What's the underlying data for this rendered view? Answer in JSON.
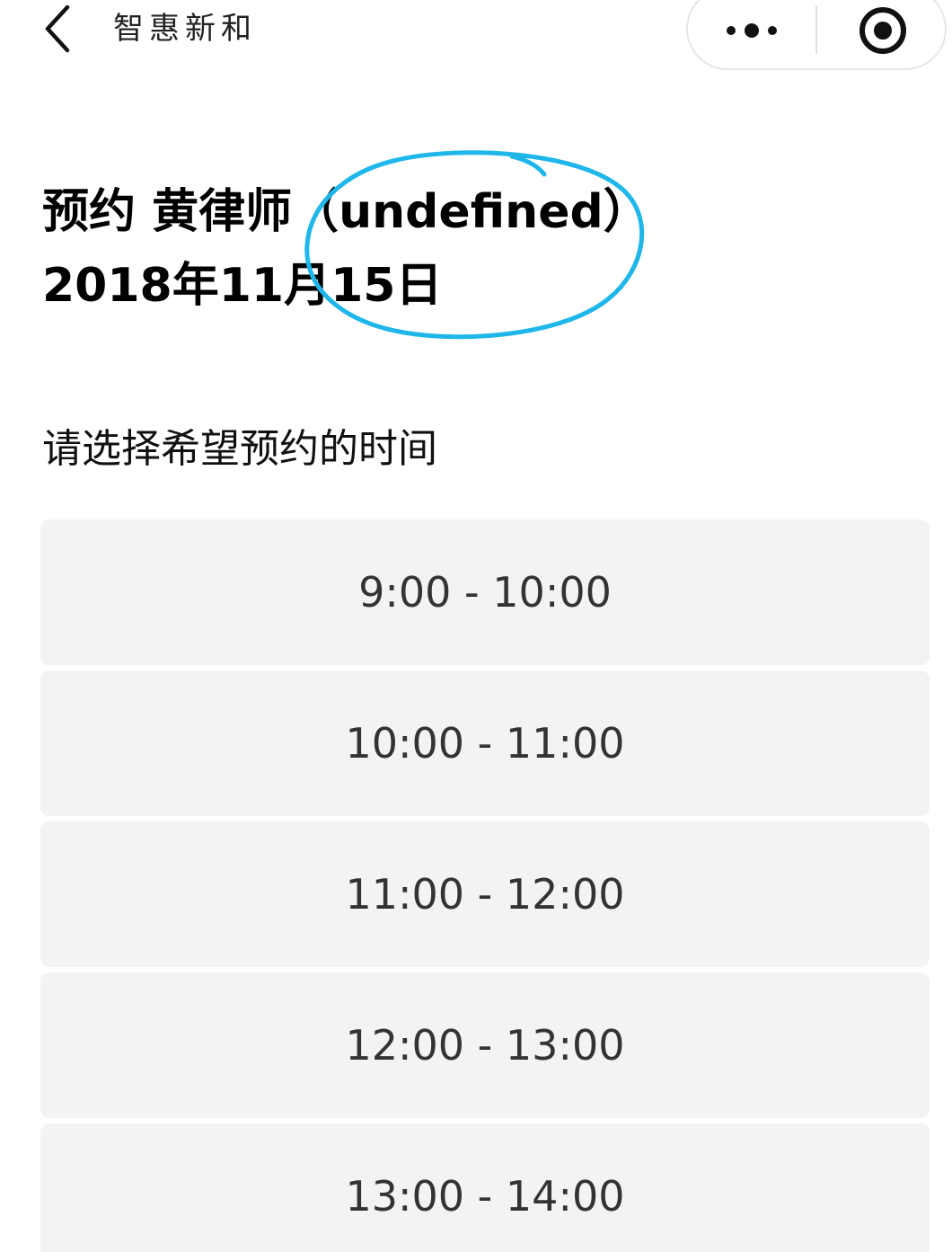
{
  "navbar": {
    "title": "智惠新和",
    "back_icon": "chevron-left-icon",
    "more_icon": "more-dots-icon",
    "close_icon": "target-close-icon"
  },
  "header": {
    "line1": "预约 黄律师（undefined）",
    "line2": "2018年11月15日",
    "annotation_color": "#1fb7ea"
  },
  "prompt": "请选择希望预约的时间",
  "slots": [
    {
      "label": "9:00 - 10:00"
    },
    {
      "label": "10:00 - 11:00"
    },
    {
      "label": "11:00 - 12:00"
    },
    {
      "label": "12:00 - 13:00"
    },
    {
      "label": "13:00 - 14:00"
    }
  ]
}
